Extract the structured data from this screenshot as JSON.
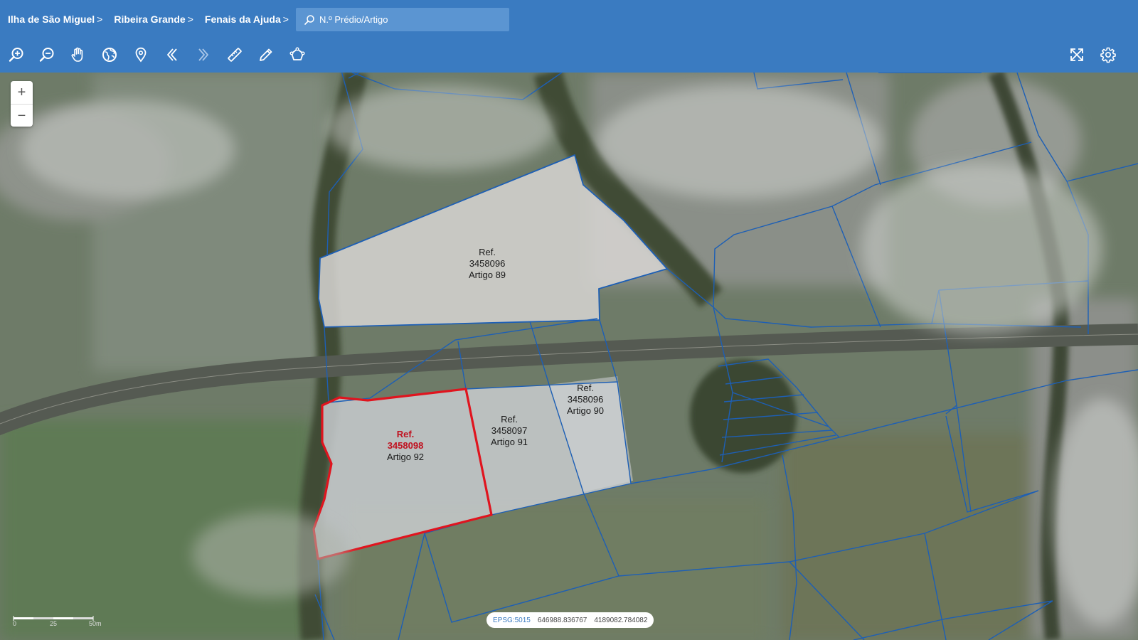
{
  "breadcrumb": [
    {
      "label": "Ilha de São Miguel"
    },
    {
      "label": "Ribeira Grande"
    },
    {
      "label": "Fenais da Ajuda"
    }
  ],
  "separator": ">",
  "search": {
    "placeholder": "N.º Prédio/Artigo"
  },
  "toolbar": {
    "left": [
      {
        "icon": "zoom-in-icon"
      },
      {
        "icon": "zoom-out-icon"
      },
      {
        "icon": "pan-hand-icon"
      },
      {
        "icon": "globe-icon"
      },
      {
        "icon": "location-pin-icon"
      },
      {
        "icon": "chevron-left-icon"
      },
      {
        "icon": "chevron-right-icon"
      },
      {
        "icon": "ruler-icon"
      },
      {
        "icon": "pencil-icon"
      },
      {
        "icon": "polygon-icon"
      }
    ],
    "right": [
      {
        "icon": "fullscreen-icon"
      },
      {
        "icon": "settings-gear-icon"
      }
    ]
  },
  "zoom": {
    "plus": "+",
    "minus": "−"
  },
  "parcels": [
    {
      "ref": "Ref.",
      "number": "3458096",
      "artigo": "Artigo 89",
      "selected": false
    },
    {
      "ref": "Ref.",
      "number": "3458096",
      "artigo": "Artigo 90",
      "selected": false
    },
    {
      "ref": "Ref.",
      "number": "3458097",
      "artigo": "Artigo 91",
      "selected": false
    },
    {
      "ref": "Ref.",
      "number": "3458098",
      "artigo": "Artigo 92",
      "selected": true
    }
  ],
  "scale": {
    "labels": [
      "0",
      "25",
      "50m"
    ]
  },
  "coordinates": {
    "epsg": "EPSG:5015",
    "x": "646988.836767",
    "y": "4189082.784082"
  },
  "colors": {
    "header": "#3a7bc1",
    "parcel_line": "#1d5fb5",
    "selected_outline": "#e0141e",
    "selected_text": "#c0111f"
  }
}
